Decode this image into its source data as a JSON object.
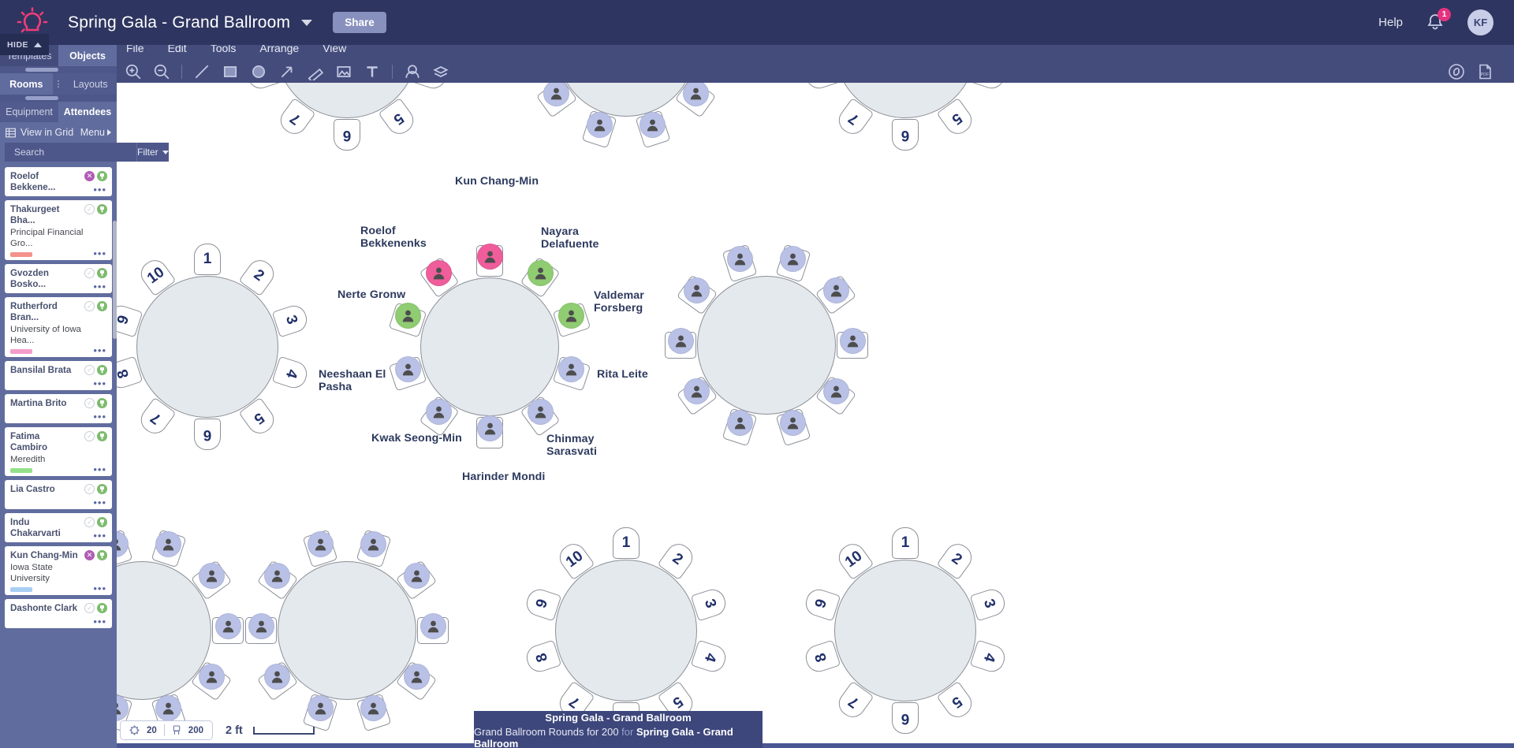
{
  "topbar": {
    "logo": "lightbulb-logo",
    "doc_title": "Spring Gala - Grand Ballroom",
    "share_label": "Share",
    "help_label": "Help",
    "notification_count": "1",
    "avatar_initials": "KF"
  },
  "hide_tab": {
    "label": "HIDE"
  },
  "menubar": {
    "items": [
      "File",
      "Edit",
      "Tools",
      "Arrange",
      "View"
    ]
  },
  "toolbar": {
    "tools": [
      "zoom-in-icon",
      "zoom-out-icon",
      "line-icon",
      "rectangle-icon",
      "ellipse-icon",
      "arrow-icon",
      "measure-icon",
      "image-icon",
      "text-icon",
      "seating-icon",
      "layers-icon"
    ],
    "right_tools": [
      "link-icon",
      "pdf-icon"
    ]
  },
  "left_panel": {
    "tabs_level1": [
      {
        "label": "Templates",
        "active": false
      },
      {
        "label": "Objects",
        "active": true
      }
    ],
    "tabs_level2": [
      {
        "label": "Rooms",
        "active": true
      },
      {
        "label": "Layouts",
        "active": false
      }
    ],
    "tabs_level3": [
      {
        "label": "Equipment",
        "active": false
      },
      {
        "label": "Attendees",
        "active": true
      }
    ],
    "view_in_grid": "View in Grid",
    "menu_label": "Menu",
    "search_placeholder": "Search",
    "search_value": "",
    "filter_label": "Filter",
    "attendees": [
      {
        "name": "Roelof Bekkene...",
        "org": "",
        "swatch": "",
        "status": "x"
      },
      {
        "name": "Thakurgeet Bha...",
        "org": "Principal Financial Gro...",
        "swatch": "#f4928b",
        "status": "check"
      },
      {
        "name": "Gvozden Bosko...",
        "org": "",
        "swatch": "",
        "status": "check"
      },
      {
        "name": "Rutherford Bran...",
        "org": "University of Iowa Hea...",
        "swatch": "#f49ccb",
        "status": "check"
      },
      {
        "name": "Bansilal Brata",
        "org": "",
        "swatch": "",
        "status": "check"
      },
      {
        "name": "Martina Brito",
        "org": "",
        "swatch": "",
        "status": "check"
      },
      {
        "name": "Fatima Cambiro",
        "org": "Meredith",
        "swatch": "#94e08a",
        "status": "check"
      },
      {
        "name": "Lia Castro",
        "org": "",
        "swatch": "",
        "status": "check"
      },
      {
        "name": "Indu Chakarvarti",
        "org": "",
        "swatch": "",
        "status": "check"
      },
      {
        "name": "Kun Chang-Min",
        "org": "Iowa State University",
        "swatch": "#a8cef4",
        "status": "x"
      },
      {
        "name": "Dashonte Clark",
        "org": "",
        "swatch": "",
        "status": "check"
      }
    ]
  },
  "canvas": {
    "center_table": {
      "seat_labels": [
        "Kun Chang-Min",
        "Nayara Delafuente",
        "Valdemar Forsberg",
        "Rita Leite",
        "Chinmay Sarasvati",
        "Harinder Mondi",
        "Kwak Seong-Min",
        "Neeshaan El Pasha",
        "Nerte Gronw",
        "Roelof Bekkenenks"
      ],
      "seat_colors": [
        "#ef5d9b",
        "#8fcc72",
        "#8fcc72",
        "#b9c1e6",
        "#b9c1e6",
        "#b9c1e6",
        "#b9c1e6",
        "#b9c1e6",
        "#8fcc72",
        "#ef5d9b"
      ]
    },
    "numbered_seats": [
      "1",
      "2",
      "3",
      "4",
      "5",
      "6",
      "7",
      "8",
      "9",
      "10"
    ],
    "table_colors": {
      "table_fill": "#e4e9ed",
      "table_stroke": "#8c9098",
      "name_text": "#2d3a5e"
    }
  },
  "status_bar": {
    "table_count": "20",
    "seat_count": "200",
    "scale_label": "2 ft"
  },
  "bottom_tooltip": {
    "line1": "Spring Gala - Grand Ballroom",
    "line2_prefix": "Grand Ballroom Rounds for 200",
    "line2_for": "for",
    "line2_suffix": "Spring Gala - Grand Ballroom"
  }
}
